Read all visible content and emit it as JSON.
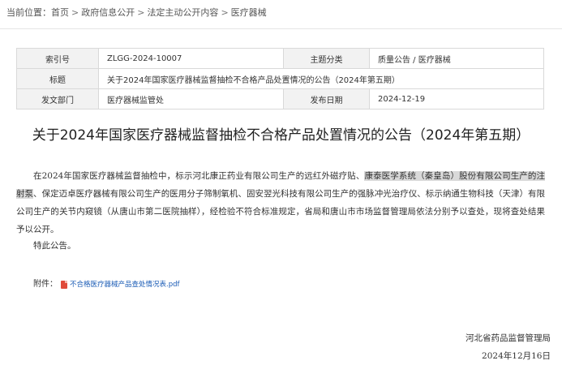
{
  "breadcrumb": {
    "prefix": "当前位置：",
    "items": [
      "首页",
      "政府信息公开",
      "法定主动公开内容",
      "医疗器械"
    ],
    "sep": ">"
  },
  "meta": {
    "index_label": "索引号",
    "index_value": "ZLGG-2024-10007",
    "topic_label": "主题分类",
    "topic_value": "质量公告 / 医疗器械",
    "title_label": "标题",
    "title_value": "关于2024年国家医疗器械监督抽检不合格产品处置情况的公告（2024年第五期）",
    "dept_label": "发文部门",
    "dept_value": "医疗器械监管处",
    "date_label": "发布日期",
    "date_value": "2024-12-19"
  },
  "article": {
    "title": "关于2024年国家医疗器械监督抽检不合格产品处置情况的公告（2024年第五期）",
    "para_a": "在2024年国家医疗器械监督抽检中，标示河北康正药业有限公司生产的远红外磁疗贴、",
    "para_highlight": "康泰医学系统（秦皇岛）股份有限公司生产的注射泵",
    "para_b": "、保定迈卓医疗器械有限公司生产的医用分子筛制氧机、固安翌光科技有限公司生产的强脉冲光治疗仪、标示纳通生物科技（天津）有限公司生产的关节内窥镜（从唐山市第二医院抽样），经检验不符合标准规定，省局和唐山市市场监督管理局依法分别予以查处，现将查处结果予以公开。",
    "closing": "特此公告。",
    "attachment_label": "附件：",
    "attachment_file": "不合格医疗器械产品查处情况表.pdf",
    "signer": "河北省药品监督管理局",
    "sign_date": "2024年12月16日"
  }
}
